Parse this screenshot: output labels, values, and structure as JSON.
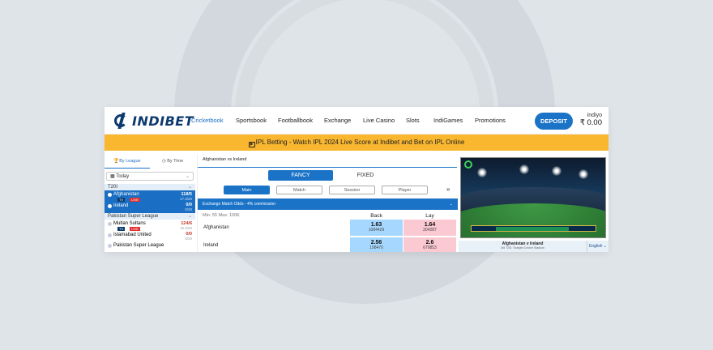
{
  "nav": {
    "brand": "INDIBET",
    "links": [
      "Cricketbook",
      "Sportsbook",
      "Footballbook",
      "Exchange",
      "Live Casino",
      "Slots",
      "IndiGames",
      "Promotions"
    ],
    "active": "Cricketbook",
    "deposit_label": "DEPOSIT",
    "username": "indiyo",
    "balance": "₹ 0.00"
  },
  "banner": {
    "text": "IPL Betting - Watch IPL 2024 Live Score at Indibet and Bet on IPL Online"
  },
  "sidebar": {
    "tab_league": "By League",
    "tab_time": "By Time",
    "filter": "Today",
    "groups": [
      {
        "name": "T20I",
        "match": {
          "team1": "Afghanistan",
          "score1": "118/5",
          "over1": "17.3/20",
          "team2": "Ireland",
          "score2": "0/0",
          "over2": "0/20",
          "tv": "TV",
          "live": "LIVE"
        }
      },
      {
        "name": "Pakistan Super League",
        "match": {
          "team1": "Multan Sultans",
          "score1": "124/6",
          "over1": "15.4/20",
          "team2": "Islamabad United",
          "score2": "0/0",
          "over2": "0/20",
          "tv": "TV",
          "live": "LIVE"
        }
      },
      {
        "name": "Pakistan Super League"
      }
    ]
  },
  "center": {
    "breadcrumb": "Afghanistan vs Ireland",
    "tab_fancy": "FANCY",
    "tab_fixed": "FIXED",
    "subtabs": [
      "Main",
      "Match",
      "Session",
      "Player"
    ],
    "market_title": "Exchange Match Odds - 4% commission",
    "minmax": "Min: 55  Max: 100K",
    "col_back": "Back",
    "col_lay": "Lay",
    "runners": [
      {
        "name": "Afghanistan",
        "back_price": "1.63",
        "back_vol": "1084429",
        "lay_price": "1.64",
        "lay_vol": "204287"
      },
      {
        "name": "Ireland",
        "back_price": "2.56",
        "back_vol": "198470",
        "lay_price": "2.6",
        "lay_vol": "679853"
      }
    ]
  },
  "stream": {
    "title": "Afghanistan v Ireland",
    "subtitle": "3rd T20I, Sharjah Cricket Stadium",
    "language": "English"
  },
  "colors": {
    "primary": "#1a73c7",
    "banner": "#f9b62f",
    "back": "#a6d8ff",
    "lay": "#fac9d1",
    "live": "#e03131"
  }
}
